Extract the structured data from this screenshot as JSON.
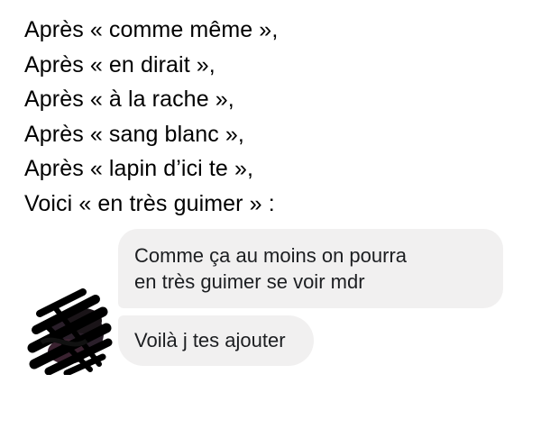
{
  "caption": {
    "lines": [
      "Après « comme même »,",
      "Après « en dirait »,",
      "Après « à la rache »,",
      "Après « sang blanc »,",
      "Après « lapin d’ici te »,",
      "Voici « en très guimer » :"
    ]
  },
  "chat": {
    "messages": [
      {
        "lines": [
          "Comme ça au moins on pourra",
          "en très guimer se voir mdr"
        ]
      },
      {
        "lines": [
          "Voilà j tes ajouter"
        ]
      }
    ],
    "avatar_icon": "scribbled-out-avatar-icon"
  }
}
